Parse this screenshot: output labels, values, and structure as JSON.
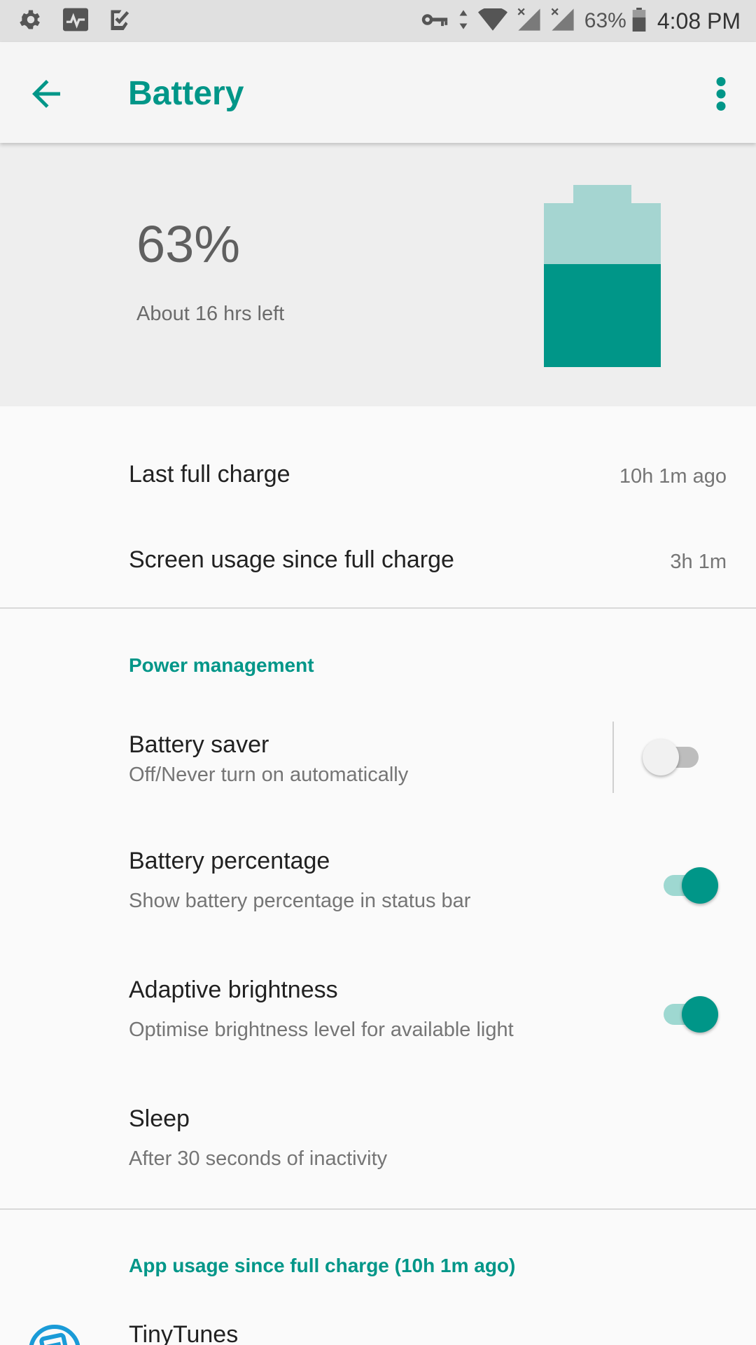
{
  "status_bar": {
    "battery_percent": "63%",
    "time": "4:08 PM",
    "left_icons": [
      "settings-gear-icon",
      "activity-pulse-icon",
      "task-check-icon"
    ],
    "right_icons": [
      "vpn-key-icon",
      "data-arrows-icon",
      "wifi-icon",
      "signal-no-sim-icon",
      "signal-no-sim-icon",
      "battery-icon"
    ]
  },
  "app_bar": {
    "title": "Battery",
    "back_icon": "arrow-back-icon",
    "more_icon": "more-vert-icon",
    "accent_color": "#009688"
  },
  "hero": {
    "percent_label": "63%",
    "time_left": "About 16 hrs left",
    "battery_level": 0.63,
    "battery_fill_color": "#009688",
    "battery_empty_color": "#a5d5d1"
  },
  "rows": {
    "last_full_charge": {
      "title": "Last full charge",
      "value": "10h 1m ago"
    },
    "screen_usage": {
      "title": "Screen usage since full charge",
      "value": "3h 1m"
    }
  },
  "power_management": {
    "header": "Power management",
    "battery_saver": {
      "title": "Battery saver",
      "summary": "Off/Never turn on automatically",
      "enabled": false
    },
    "battery_percentage": {
      "title": "Battery percentage",
      "summary": "Show battery percentage in status bar",
      "enabled": true
    },
    "adaptive_brightness": {
      "title": "Adaptive brightness",
      "summary": "Optimise brightness level for available light",
      "enabled": true
    },
    "sleep": {
      "title": "Sleep",
      "summary": "After 30 seconds of inactivity"
    }
  },
  "app_usage": {
    "header": "App usage since full charge (10h 1m ago)",
    "apps": [
      {
        "name": "TinyTunes",
        "icon": "tinytunes-app-icon"
      }
    ]
  }
}
